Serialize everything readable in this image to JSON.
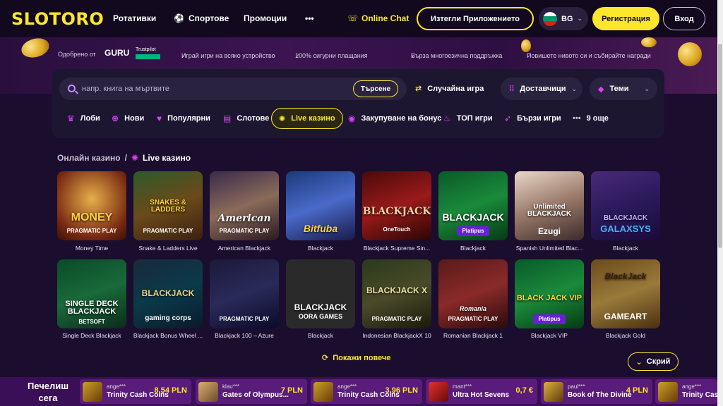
{
  "header": {
    "logo": "SLOTORO",
    "nav": [
      "Ротативки",
      "Спортове",
      "Промоции"
    ],
    "more": "•••",
    "online_chat": "Online Chat",
    "download_app": "Изтегли Приложението",
    "lang": "BG",
    "register": "Регистрация",
    "login": "Вход"
  },
  "trust": {
    "approved_by": "Одобрено от",
    "guru": "GURU",
    "trustpilot": "Trustpilot",
    "items": [
      "Играй игри на всяко устройство",
      "100% сигурни плащания",
      "Бърза многоезична поддръжка",
      "Повишете нивото си и събирайте награди"
    ]
  },
  "search": {
    "placeholder": "напр. книга на мъртвите",
    "button": "Търсене",
    "random": "Случайна игра",
    "providers": "Доставчици",
    "themes": "Теми"
  },
  "categories": [
    {
      "label": "Лоби"
    },
    {
      "label": "Нови"
    },
    {
      "label": "Популярни"
    },
    {
      "label": "Слотове"
    },
    {
      "label": "Live казино"
    },
    {
      "label": "Закупуване на бонус"
    },
    {
      "label": "ТОП игри"
    },
    {
      "label": "Бързи игри"
    },
    {
      "label": "9 още"
    }
  ],
  "breadcrumb": {
    "parent": "Онлайн казино",
    "separator": "/",
    "current": "Live казино"
  },
  "games": [
    {
      "name": "Money Time",
      "art": "MONEY",
      "provider": "PRAGMATIC PLAY"
    },
    {
      "name": "Snake & Ladders Live",
      "art": "SNAKES & LADDERS",
      "provider": "PRAGMATIC PLAY"
    },
    {
      "name": "American Blackjack",
      "art": "American",
      "provider": "PRAGMATIC PLAY"
    },
    {
      "name": "Blackjack",
      "art": "Bitfuba",
      "provider": ""
    },
    {
      "name": "Blackjack Supreme Sin...",
      "art": "BLACKJACK",
      "provider": "OneTouch"
    },
    {
      "name": "Blackjack",
      "art": "BLACKJACK",
      "provider": "Platipus"
    },
    {
      "name": "Spanish Unlimited Blac...",
      "art": "Unlimited BLACKJACK",
      "provider": "Ezugi"
    },
    {
      "name": "Blackjack",
      "art": "BLACKJACK",
      "provider": "GALAXSYS"
    },
    {
      "name": "Single Deck Blackjack",
      "art": "SINGLE DECK BLACKJACK",
      "provider": "BETSOFT"
    },
    {
      "name": "Blackjack Bonus Wheel ...",
      "art": "BLACKJACK",
      "provider": "gaming corps"
    },
    {
      "name": "Blackjack 100 – Azure",
      "art": "",
      "provider": "PRAGMATIC PLAY"
    },
    {
      "name": "Blackjack",
      "art": "BLACKJACK",
      "provider": "OORA GAMES"
    },
    {
      "name": "Indonesian BlackjackX 10",
      "art": "BLACKJACK X",
      "provider": "PRAGMATIC PLAY"
    },
    {
      "name": "Romanian Blackjack 1",
      "art": "Romania",
      "provider": "PRAGMATIC PLAY"
    },
    {
      "name": "Blackjack VIP",
      "art": "BLACK JACK VIP",
      "provider": "Platipus"
    },
    {
      "name": "Blackjack Gold",
      "art": "BlackJack",
      "provider": "GAMEART"
    }
  ],
  "show_more": "Покажи повече",
  "hide": "Скрий",
  "winners": {
    "title": "Печелиш сега",
    "items": [
      {
        "user": "ange***",
        "game": "Trinity Cash Coins",
        "amount": "8,54 PLN"
      },
      {
        "user": "klau***",
        "game": "Gates of Olympus...",
        "amount": "7 PLN"
      },
      {
        "user": "ange***",
        "game": "Trinity Cash Coins",
        "amount": "3,96 PLN"
      },
      {
        "user": "mant***",
        "game": "Ultra Hot Sevens",
        "amount": "0,7 €"
      },
      {
        "user": "paul***",
        "game": "Book of The Divine",
        "amount": "4 PLN"
      },
      {
        "user": "ange***",
        "game": "Trinity Cas",
        "amount": ""
      }
    ]
  },
  "colors": {
    "accent": "#fce72c",
    "pink": "#e040fb",
    "bg": "#1a0d2e"
  }
}
